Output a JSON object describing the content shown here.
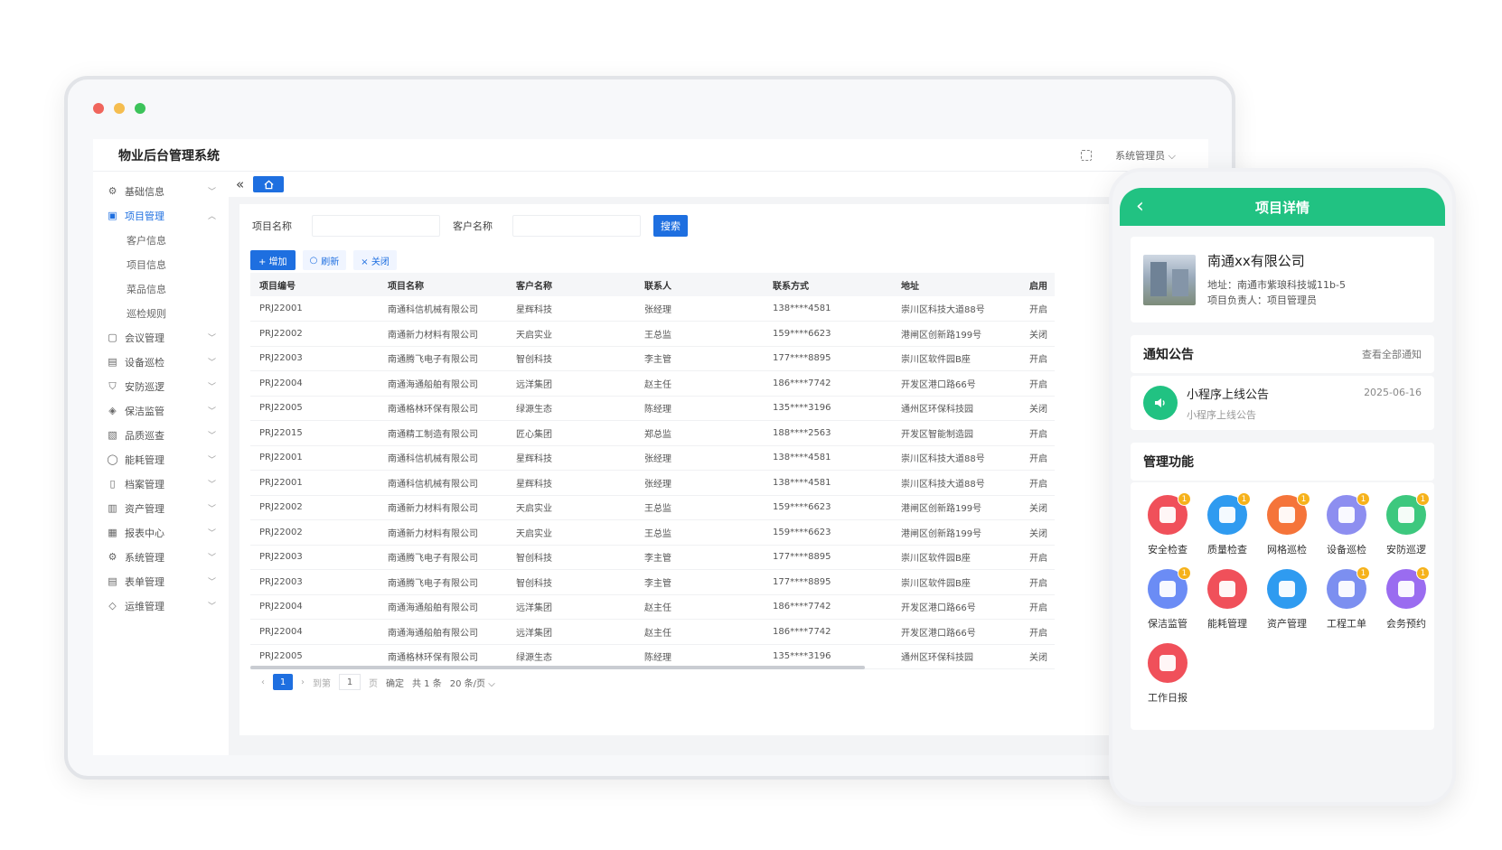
{
  "app": {
    "title": "物业后台管理系统",
    "user": "系统管理员"
  },
  "sidebar": {
    "items": [
      {
        "label": "基础信息",
        "icon": "gear-icon",
        "expanded": false
      },
      {
        "label": "项目管理",
        "icon": "project-icon",
        "expanded": true,
        "active": true,
        "children": [
          "客户信息",
          "项目信息",
          "菜品信息",
          "巡检规则"
        ]
      },
      {
        "label": "会议管理",
        "icon": "meeting-icon",
        "expanded": false
      },
      {
        "label": "设备巡检",
        "icon": "device-icon",
        "expanded": false
      },
      {
        "label": "安防巡逻",
        "icon": "shield-icon",
        "expanded": false
      },
      {
        "label": "保洁监管",
        "icon": "broom-icon",
        "expanded": false
      },
      {
        "label": "品质巡查",
        "icon": "quality-icon",
        "expanded": false
      },
      {
        "label": "能耗管理",
        "icon": "energy-icon",
        "expanded": false
      },
      {
        "label": "档案管理",
        "icon": "file-icon",
        "expanded": false
      },
      {
        "label": "资产管理",
        "icon": "asset-icon",
        "expanded": false
      },
      {
        "label": "报表中心",
        "icon": "chart-icon",
        "expanded": false
      },
      {
        "label": "系统管理",
        "icon": "settings-icon",
        "expanded": false
      },
      {
        "label": "表单管理",
        "icon": "form-icon",
        "expanded": false
      },
      {
        "label": "运维管理",
        "icon": "ops-icon",
        "expanded": false
      }
    ]
  },
  "search": {
    "project_label": "项目名称",
    "customer_label": "客户名称",
    "project_value": "",
    "customer_value": "",
    "button": "搜索"
  },
  "toolbar": {
    "add": "+ 增加",
    "refresh": "刷新",
    "close": "× 关闭"
  },
  "table": {
    "columns": [
      "项目编号",
      "项目名称",
      "客户名称",
      "联系人",
      "联系方式",
      "地址",
      "启用"
    ],
    "rows": [
      [
        "PRJ22001",
        "南通科信机械有限公司",
        "星辉科技",
        "张经理",
        "138****4581",
        "崇川区科技大道88号",
        "开启"
      ],
      [
        "PRJ22002",
        "南通新力材料有限公司",
        "天启实业",
        "王总监",
        "159****6623",
        "港闸区创新路199号",
        "关闭"
      ],
      [
        "PRJ22003",
        "南通腾飞电子有限公司",
        "智创科技",
        "李主管",
        "177****8895",
        "崇川区软件园B座",
        "开启"
      ],
      [
        "PRJ22004",
        "南通海通船舶有限公司",
        "远洋集团",
        "赵主任",
        "186****7742",
        "开发区港口路66号",
        "开启"
      ],
      [
        "PRJ22005",
        "南通格林环保有限公司",
        "绿源生态",
        "陈经理",
        "135****3196",
        "通州区环保科技园",
        "关闭"
      ],
      [
        "PRJ22015",
        "南通精工制造有限公司",
        "匠心集团",
        "郑总监",
        "188****2563",
        "开发区智能制造园",
        "开启"
      ],
      [
        "PRJ22001",
        "南通科信机械有限公司",
        "星辉科技",
        "张经理",
        "138****4581",
        "崇川区科技大道88号",
        "开启"
      ],
      [
        "PRJ22001",
        "南通科信机械有限公司",
        "星辉科技",
        "张经理",
        "138****4581",
        "崇川区科技大道88号",
        "开启"
      ],
      [
        "PRJ22002",
        "南通新力材料有限公司",
        "天启实业",
        "王总监",
        "159****6623",
        "港闸区创新路199号",
        "关闭"
      ],
      [
        "PRJ22002",
        "南通新力材料有限公司",
        "天启实业",
        "王总监",
        "159****6623",
        "港闸区创新路199号",
        "关闭"
      ],
      [
        "PRJ22003",
        "南通腾飞电子有限公司",
        "智创科技",
        "李主管",
        "177****8895",
        "崇川区软件园B座",
        "开启"
      ],
      [
        "PRJ22003",
        "南通腾飞电子有限公司",
        "智创科技",
        "李主管",
        "177****8895",
        "崇川区软件园B座",
        "开启"
      ],
      [
        "PRJ22004",
        "南通海通船舶有限公司",
        "远洋集团",
        "赵主任",
        "186****7742",
        "开发区港口路66号",
        "开启"
      ],
      [
        "PRJ22004",
        "南通海通船舶有限公司",
        "远洋集团",
        "赵主任",
        "186****7742",
        "开发区港口路66号",
        "开启"
      ],
      [
        "PRJ22005",
        "南通格林环保有限公司",
        "绿源生态",
        "陈经理",
        "135****3196",
        "通州区环保科技园",
        "关闭"
      ]
    ]
  },
  "pagination": {
    "current": "1",
    "goto_label": "到第",
    "goto_value": "1",
    "page_unit": "页",
    "confirm": "确定",
    "total": "共 1 条",
    "page_size": "20 条/页"
  },
  "phone": {
    "title": "项目详情",
    "company": {
      "name": "南通xx有限公司",
      "address": "地址：南通市紫琅科技城11b-5",
      "manager": "项目负责人：项目管理员"
    },
    "notice": {
      "title": "通知公告",
      "more": "查看全部通知",
      "item_title": "小程序上线公告",
      "item_sub": "小程序上线公告",
      "item_date": "2025-06-16"
    },
    "functions": {
      "title": "管理功能",
      "items": [
        {
          "label": "安全检查",
          "color": "#f0505a",
          "badge": "1",
          "icon": "safety-check-icon"
        },
        {
          "label": "质量检查",
          "color": "#2f9bf0",
          "badge": "1",
          "icon": "quality-check-icon"
        },
        {
          "label": "网格巡检",
          "color": "#f5743a",
          "badge": "1",
          "icon": "grid-inspect-icon"
        },
        {
          "label": "设备巡检",
          "color": "#8d8ef0",
          "badge": "1",
          "icon": "device-inspect-icon"
        },
        {
          "label": "安防巡逻",
          "color": "#3dc87e",
          "badge": "1",
          "icon": "security-patrol-icon"
        },
        {
          "label": "保洁监管",
          "color": "#6b8cf5",
          "badge": "1",
          "icon": "cleaning-icon"
        },
        {
          "label": "能耗管理",
          "color": "#f0505a",
          "badge": "",
          "icon": "energy-icon"
        },
        {
          "label": "资产管理",
          "color": "#2f9bf0",
          "badge": "",
          "icon": "asset-icon"
        },
        {
          "label": "工程工单",
          "color": "#7c8ff0",
          "badge": "1",
          "icon": "work-order-icon"
        },
        {
          "label": "会务预约",
          "color": "#9a6cf0",
          "badge": "1",
          "icon": "meeting-booking-icon"
        },
        {
          "label": "工作日报",
          "color": "#f0505a",
          "badge": "",
          "icon": "daily-report-icon"
        }
      ]
    }
  }
}
